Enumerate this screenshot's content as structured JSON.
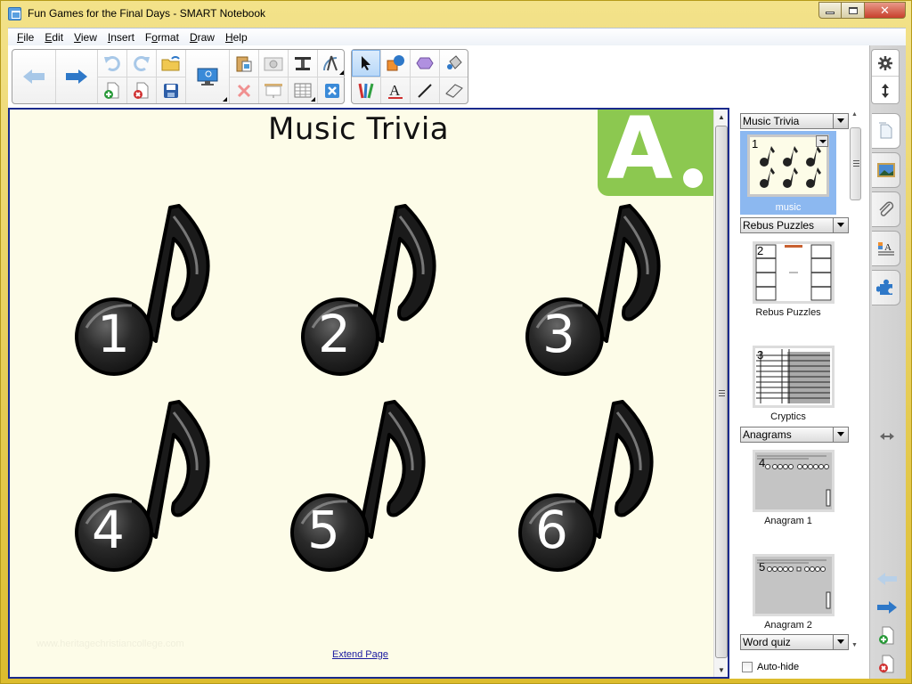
{
  "window": {
    "title": "Fun Games for the Final Days - SMART Notebook",
    "controls": {
      "minimize": "minimize",
      "maximize": "maximize",
      "close": "✕"
    }
  },
  "menubar": {
    "items": [
      {
        "label": "File",
        "underline": "F",
        "rest": "ile"
      },
      {
        "label": "Edit",
        "underline": "E",
        "rest": "dit"
      },
      {
        "label": "View",
        "underline": "V",
        "rest": "iew"
      },
      {
        "label": "Insert",
        "underline": "I",
        "rest": "nsert"
      },
      {
        "label": "Format",
        "pre": "F",
        "underline": "o",
        "rest": "rmat"
      },
      {
        "label": "Draw",
        "underline": "D",
        "rest": "raw"
      },
      {
        "label": "Help",
        "underline": "H",
        "rest": "elp"
      }
    ]
  },
  "toolbar": {
    "navigation": [
      "previous-page",
      "next-page"
    ],
    "file_tools": [
      "undo",
      "redo",
      "open-file",
      "add-page",
      "delete-page",
      "save",
      "screen-shade"
    ],
    "insert_tools": [
      "paste",
      "screen-capture",
      "document-camera",
      "measurement-tools",
      "delete",
      "show-screen",
      "insert-table",
      "full-screen"
    ],
    "draw_tools": [
      "select",
      "shapes",
      "regular-polygons",
      "fill",
      "pens",
      "text",
      "lines",
      "eraser"
    ],
    "selected_tool": "select"
  },
  "page": {
    "title": "Music Trivia",
    "badge": "A",
    "notes": [
      "1",
      "2",
      "3",
      "4",
      "5",
      "6"
    ],
    "watermark": "www.heritagechristiancollege.com",
    "extend_link": "Extend Page"
  },
  "page_sorter": {
    "groups": [
      {
        "name": "Music Trivia",
        "pages": [
          {
            "number": "1",
            "label": "music",
            "selected": true
          }
        ]
      },
      {
        "name": "Rebus Puzzles",
        "pages": [
          {
            "number": "2",
            "label": "Rebus Puzzles"
          },
          {
            "number": "3",
            "label": "Cryptics"
          }
        ]
      },
      {
        "name": "Anagrams",
        "pages": [
          {
            "number": "4",
            "label": "Anagram 1"
          },
          {
            "number": "5",
            "label": "Anagram 2"
          }
        ]
      },
      {
        "name": "Word quiz",
        "pages": []
      }
    ],
    "auto_hide_label": "Auto-hide",
    "auto_hide_checked": false
  },
  "side_tabs": [
    "page-sorter",
    "gallery",
    "attachments",
    "properties",
    "add-ons"
  ],
  "colors": {
    "accent_green": "#8cc850",
    "canvas_bg": "#fdfce8",
    "selection_blue": "#8cb8f0",
    "frame_border": "#1a2a8c"
  }
}
